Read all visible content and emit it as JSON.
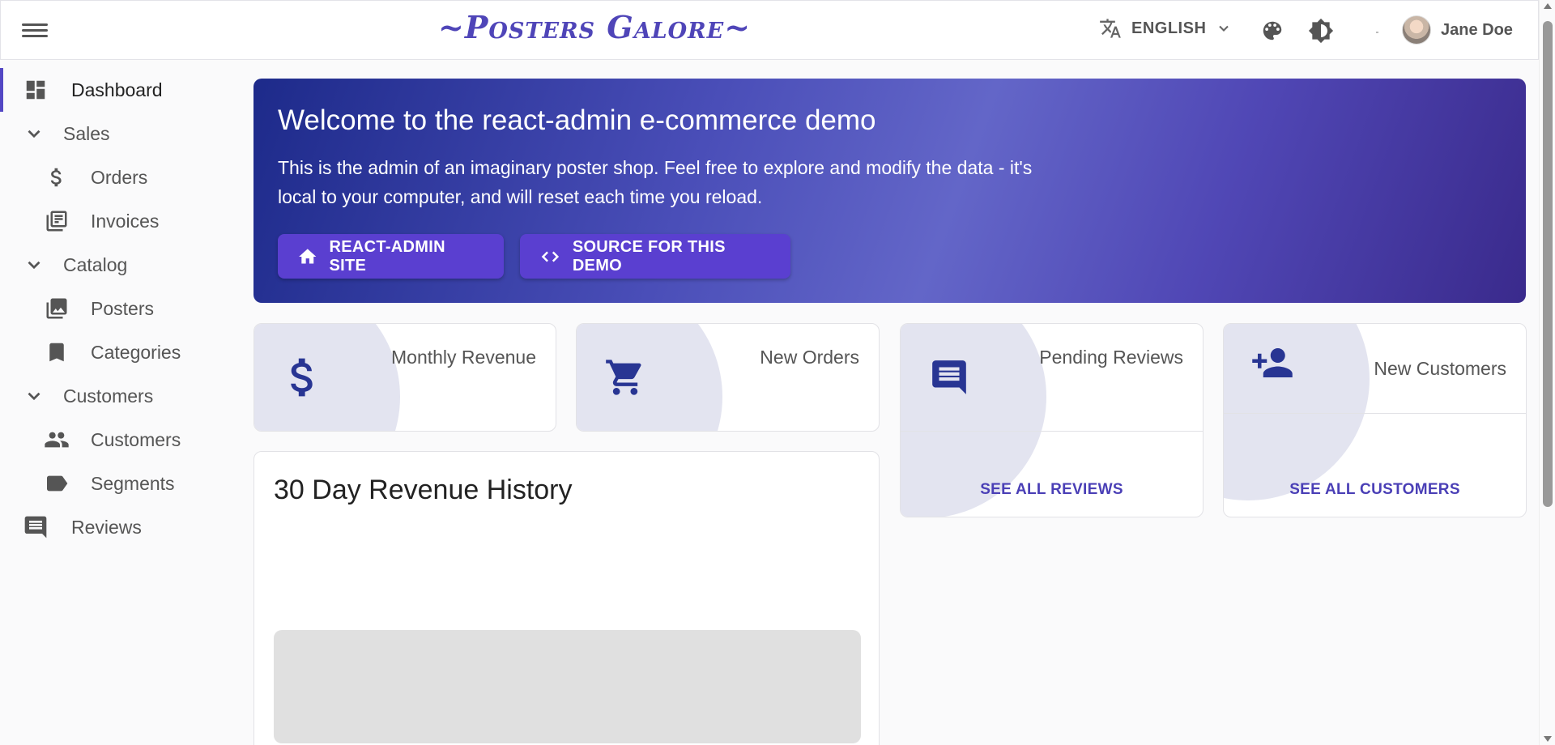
{
  "appbar": {
    "brand": "~Posters Galore~",
    "language": "ENGLISH",
    "user_name": "Jane Doe"
  },
  "sidebar": {
    "items": [
      {
        "label": "Dashboard",
        "icon": "dashboard-icon",
        "active": true
      },
      {
        "label": "Sales",
        "icon": "chevron-down-icon"
      },
      {
        "label": "Orders",
        "icon": "dollar-icon"
      },
      {
        "label": "Invoices",
        "icon": "invoices-icon"
      },
      {
        "label": "Catalog",
        "icon": "chevron-down-icon"
      },
      {
        "label": "Posters",
        "icon": "image-collection-icon"
      },
      {
        "label": "Categories",
        "icon": "bookmark-icon"
      },
      {
        "label": "Customers",
        "icon": "chevron-down-icon"
      },
      {
        "label": "Customers",
        "icon": "people-icon"
      },
      {
        "label": "Segments",
        "icon": "label-icon"
      },
      {
        "label": "Reviews",
        "icon": "comment-icon"
      }
    ]
  },
  "hero": {
    "title": "Welcome to the react-admin e-commerce demo",
    "text": "This is the admin of an imaginary poster shop. Feel free to explore and modify the data - it's local to your computer, and will reset each time you reload.",
    "buttons": [
      {
        "label": "REACT-ADMIN SITE",
        "icon": "home-icon"
      },
      {
        "label": "SOURCE FOR THIS DEMO",
        "icon": "code-icon"
      }
    ]
  },
  "stats": [
    {
      "title": "Monthly Revenue",
      "icon": "dollar-icon"
    },
    {
      "title": "New Orders",
      "icon": "shopping-cart-icon"
    },
    {
      "title": "Pending Reviews",
      "icon": "comment-icon",
      "link": "SEE ALL REVIEWS"
    },
    {
      "title": "New Customers",
      "icon": "person-add-icon",
      "link": "SEE ALL CUSTOMERS"
    }
  ],
  "revenue_chart": {
    "title": "30 Day Revenue History"
  },
  "colors": {
    "accent": "#5347c4",
    "icon": "#283593",
    "hero_button": "#5a3fd0"
  }
}
